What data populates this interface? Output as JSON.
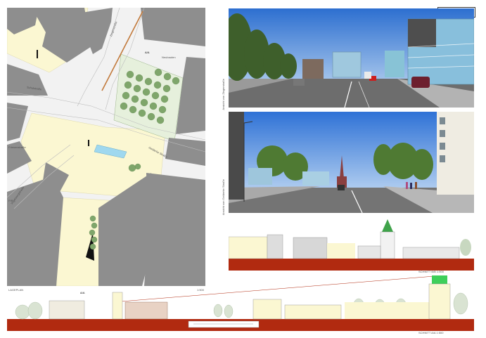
{
  "project_number": "013240",
  "site_plan": {
    "streets": [
      "Zingerstraße",
      "Schulstraße",
      "Friesenstraße",
      "Vogelsangstraße",
      "Gelderke Straße",
      "Neubauten",
      "P/R"
    ],
    "section_marker": "A/A",
    "caption": "LAGEPLAN",
    "scale": "1:500"
  },
  "views": [
    {
      "label": "Ansicht von Zingerstraße"
    },
    {
      "label": "Ansicht von Gelderke Straße"
    }
  ],
  "sections": [
    {
      "caption": "SCHNITT B/B   1:500"
    },
    {
      "caption": "SCHNITT A/A   1:500"
    }
  ],
  "bottom_marker": "A/A",
  "colors": {
    "buildings": "#8e8e8e",
    "plaza": "#fbf7d2",
    "street": "#eeeeee",
    "ground_section": "#b12a10",
    "water": "#9fd8ef",
    "trees": "#7fa66b",
    "sky": "#3f8fe0"
  }
}
